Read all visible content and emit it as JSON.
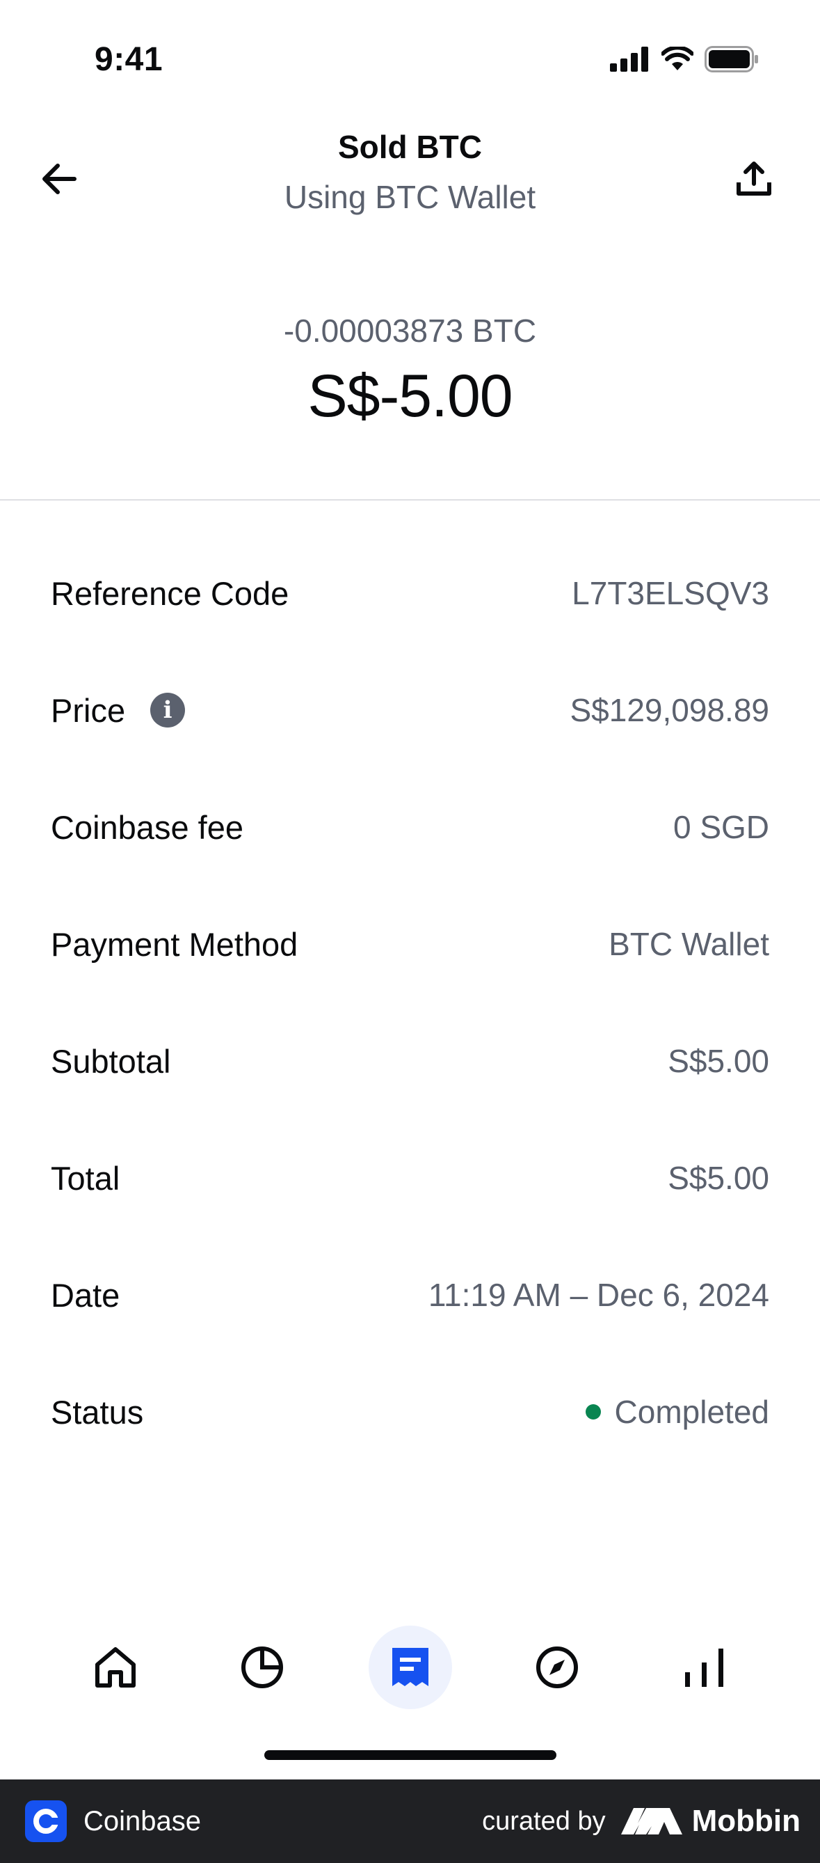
{
  "status_bar": {
    "time": "9:41"
  },
  "header": {
    "title": "Sold BTC",
    "subtitle": "Using BTC Wallet",
    "icons": {
      "back": "arrow-left-icon",
      "share": "share-upload-icon"
    }
  },
  "amount": {
    "crypto": "-0.00003873 BTC",
    "fiat": "S$-5.00"
  },
  "details": [
    {
      "label": "Reference Code",
      "value": "L7T3ELSQV3"
    },
    {
      "label": "Price",
      "value": "S$129,098.89",
      "info_icon": "i"
    },
    {
      "label": "Coinbase fee",
      "value": "0 SGD"
    },
    {
      "label": "Payment Method",
      "value": "BTC Wallet"
    },
    {
      "label": "Subtotal",
      "value": "S$5.00"
    },
    {
      "label": "Total",
      "value": "S$5.00"
    },
    {
      "label": "Date",
      "value": "11:19 AM – Dec 6, 2024"
    },
    {
      "label": "Status",
      "value": "Completed",
      "status_color": "#098551"
    }
  ],
  "tab_bar": {
    "tabs": [
      "home-icon",
      "portfolio-pie-icon",
      "transactions-receipt-icon",
      "explore-compass-icon",
      "trade-bars-icon"
    ],
    "active_index": 2,
    "active_color": "#1652f0"
  },
  "footer": {
    "app_name": "Coinbase",
    "curated_by": "curated by",
    "brand": "Mobbin"
  }
}
